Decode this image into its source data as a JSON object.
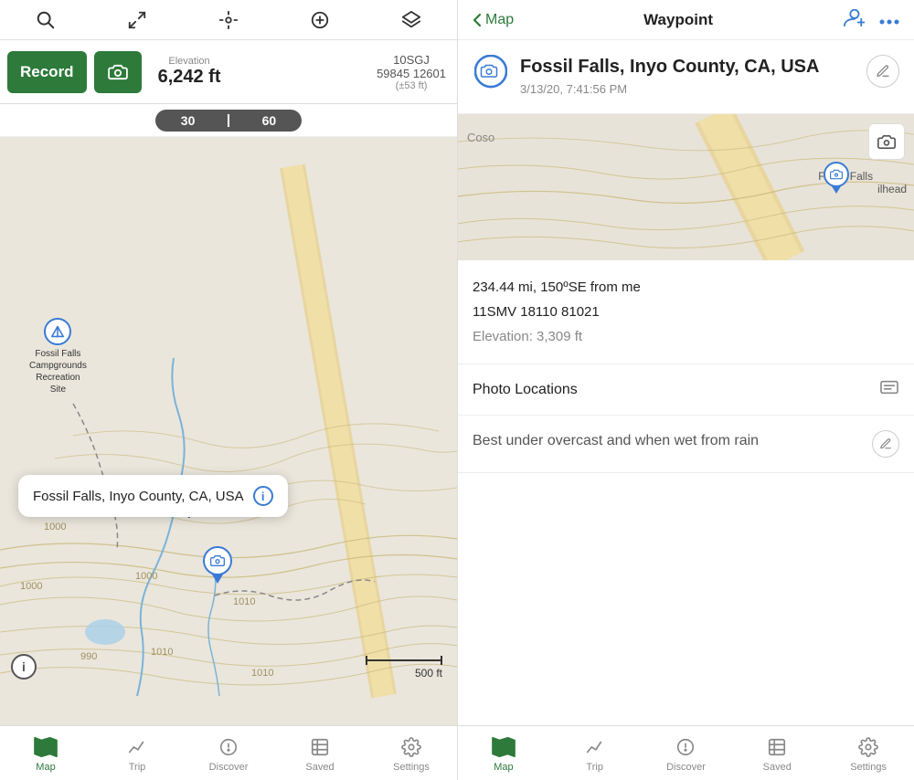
{
  "left": {
    "topBar": {
      "icons": [
        "search",
        "expand",
        "location",
        "add-circle",
        "layers"
      ]
    },
    "actionBar": {
      "recordLabel": "Record",
      "elevationLabel": "Elevation",
      "elevationValue": "6,242 ft",
      "coordsLine1": "10SGJ",
      "coordsLine2": "59845 12601",
      "coordsAcc": "(±53 ft)"
    },
    "scaleBar": {
      "tick1": "30",
      "tick2": "60"
    },
    "popup": {
      "text": "Fossil Falls, Inyo County, CA, USA"
    },
    "campground": {
      "label": "Fossil Falls\nCampgrounds\nRecreation\nSite"
    },
    "scaleIndicator": {
      "label": "500 ft"
    },
    "bottomNav": [
      {
        "id": "map",
        "label": "Map",
        "active": true
      },
      {
        "id": "trip",
        "label": "Trip",
        "active": false
      },
      {
        "id": "discover",
        "label": "Discover",
        "active": false
      },
      {
        "id": "saved",
        "label": "Saved",
        "active": false
      },
      {
        "id": "settings",
        "label": "Settings",
        "active": false
      }
    ]
  },
  "right": {
    "topBar": {
      "backLabel": "Map",
      "title": "Waypoint",
      "addPersonIcon": "add-person",
      "moreIcon": "more"
    },
    "waypoint": {
      "name": "Fossil Falls, Inyo County, CA, USA",
      "date": "3/13/20, 7:41:56 PM"
    },
    "details": {
      "distance": "234.44 mi, 150ºSE from me",
      "coords": "11SMV 18110 81021",
      "elevationLabel": "Elevation:",
      "elevationValue": "3,309 ft"
    },
    "photoLocations": {
      "label": "Photo Locations"
    },
    "note": {
      "text": "Best under overcast and when wet from rain"
    },
    "bottomNav": [
      {
        "id": "map",
        "label": "Map",
        "active": true
      },
      {
        "id": "trip",
        "label": "Trip",
        "active": false
      },
      {
        "id": "discover",
        "label": "Discover",
        "active": false
      },
      {
        "id": "saved",
        "label": "Saved",
        "active": false
      },
      {
        "id": "settings",
        "label": "Settings",
        "active": false
      }
    ]
  }
}
